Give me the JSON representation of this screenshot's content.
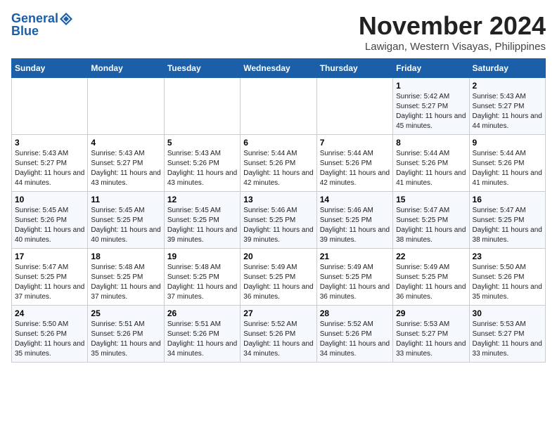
{
  "header": {
    "logo_general": "General",
    "logo_blue": "Blue",
    "month_title": "November 2024",
    "location": "Lawigan, Western Visayas, Philippines"
  },
  "days_of_week": [
    "Sunday",
    "Monday",
    "Tuesday",
    "Wednesday",
    "Thursday",
    "Friday",
    "Saturday"
  ],
  "weeks": [
    [
      {
        "day": "",
        "sunrise": "",
        "sunset": "",
        "daylight": ""
      },
      {
        "day": "",
        "sunrise": "",
        "sunset": "",
        "daylight": ""
      },
      {
        "day": "",
        "sunrise": "",
        "sunset": "",
        "daylight": ""
      },
      {
        "day": "",
        "sunrise": "",
        "sunset": "",
        "daylight": ""
      },
      {
        "day": "",
        "sunrise": "",
        "sunset": "",
        "daylight": ""
      },
      {
        "day": "1",
        "sunrise": "Sunrise: 5:42 AM",
        "sunset": "Sunset: 5:27 PM",
        "daylight": "Daylight: 11 hours and 45 minutes."
      },
      {
        "day": "2",
        "sunrise": "Sunrise: 5:43 AM",
        "sunset": "Sunset: 5:27 PM",
        "daylight": "Daylight: 11 hours and 44 minutes."
      }
    ],
    [
      {
        "day": "3",
        "sunrise": "Sunrise: 5:43 AM",
        "sunset": "Sunset: 5:27 PM",
        "daylight": "Daylight: 11 hours and 44 minutes."
      },
      {
        "day": "4",
        "sunrise": "Sunrise: 5:43 AM",
        "sunset": "Sunset: 5:27 PM",
        "daylight": "Daylight: 11 hours and 43 minutes."
      },
      {
        "day": "5",
        "sunrise": "Sunrise: 5:43 AM",
        "sunset": "Sunset: 5:26 PM",
        "daylight": "Daylight: 11 hours and 43 minutes."
      },
      {
        "day": "6",
        "sunrise": "Sunrise: 5:44 AM",
        "sunset": "Sunset: 5:26 PM",
        "daylight": "Daylight: 11 hours and 42 minutes."
      },
      {
        "day": "7",
        "sunrise": "Sunrise: 5:44 AM",
        "sunset": "Sunset: 5:26 PM",
        "daylight": "Daylight: 11 hours and 42 minutes."
      },
      {
        "day": "8",
        "sunrise": "Sunrise: 5:44 AM",
        "sunset": "Sunset: 5:26 PM",
        "daylight": "Daylight: 11 hours and 41 minutes."
      },
      {
        "day": "9",
        "sunrise": "Sunrise: 5:44 AM",
        "sunset": "Sunset: 5:26 PM",
        "daylight": "Daylight: 11 hours and 41 minutes."
      }
    ],
    [
      {
        "day": "10",
        "sunrise": "Sunrise: 5:45 AM",
        "sunset": "Sunset: 5:26 PM",
        "daylight": "Daylight: 11 hours and 40 minutes."
      },
      {
        "day": "11",
        "sunrise": "Sunrise: 5:45 AM",
        "sunset": "Sunset: 5:25 PM",
        "daylight": "Daylight: 11 hours and 40 minutes."
      },
      {
        "day": "12",
        "sunrise": "Sunrise: 5:45 AM",
        "sunset": "Sunset: 5:25 PM",
        "daylight": "Daylight: 11 hours and 39 minutes."
      },
      {
        "day": "13",
        "sunrise": "Sunrise: 5:46 AM",
        "sunset": "Sunset: 5:25 PM",
        "daylight": "Daylight: 11 hours and 39 minutes."
      },
      {
        "day": "14",
        "sunrise": "Sunrise: 5:46 AM",
        "sunset": "Sunset: 5:25 PM",
        "daylight": "Daylight: 11 hours and 39 minutes."
      },
      {
        "day": "15",
        "sunrise": "Sunrise: 5:47 AM",
        "sunset": "Sunset: 5:25 PM",
        "daylight": "Daylight: 11 hours and 38 minutes."
      },
      {
        "day": "16",
        "sunrise": "Sunrise: 5:47 AM",
        "sunset": "Sunset: 5:25 PM",
        "daylight": "Daylight: 11 hours and 38 minutes."
      }
    ],
    [
      {
        "day": "17",
        "sunrise": "Sunrise: 5:47 AM",
        "sunset": "Sunset: 5:25 PM",
        "daylight": "Daylight: 11 hours and 37 minutes."
      },
      {
        "day": "18",
        "sunrise": "Sunrise: 5:48 AM",
        "sunset": "Sunset: 5:25 PM",
        "daylight": "Daylight: 11 hours and 37 minutes."
      },
      {
        "day": "19",
        "sunrise": "Sunrise: 5:48 AM",
        "sunset": "Sunset: 5:25 PM",
        "daylight": "Daylight: 11 hours and 37 minutes."
      },
      {
        "day": "20",
        "sunrise": "Sunrise: 5:49 AM",
        "sunset": "Sunset: 5:25 PM",
        "daylight": "Daylight: 11 hours and 36 minutes."
      },
      {
        "day": "21",
        "sunrise": "Sunrise: 5:49 AM",
        "sunset": "Sunset: 5:25 PM",
        "daylight": "Daylight: 11 hours and 36 minutes."
      },
      {
        "day": "22",
        "sunrise": "Sunrise: 5:49 AM",
        "sunset": "Sunset: 5:25 PM",
        "daylight": "Daylight: 11 hours and 36 minutes."
      },
      {
        "day": "23",
        "sunrise": "Sunrise: 5:50 AM",
        "sunset": "Sunset: 5:26 PM",
        "daylight": "Daylight: 11 hours and 35 minutes."
      }
    ],
    [
      {
        "day": "24",
        "sunrise": "Sunrise: 5:50 AM",
        "sunset": "Sunset: 5:26 PM",
        "daylight": "Daylight: 11 hours and 35 minutes."
      },
      {
        "day": "25",
        "sunrise": "Sunrise: 5:51 AM",
        "sunset": "Sunset: 5:26 PM",
        "daylight": "Daylight: 11 hours and 35 minutes."
      },
      {
        "day": "26",
        "sunrise": "Sunrise: 5:51 AM",
        "sunset": "Sunset: 5:26 PM",
        "daylight": "Daylight: 11 hours and 34 minutes."
      },
      {
        "day": "27",
        "sunrise": "Sunrise: 5:52 AM",
        "sunset": "Sunset: 5:26 PM",
        "daylight": "Daylight: 11 hours and 34 minutes."
      },
      {
        "day": "28",
        "sunrise": "Sunrise: 5:52 AM",
        "sunset": "Sunset: 5:26 PM",
        "daylight": "Daylight: 11 hours and 34 minutes."
      },
      {
        "day": "29",
        "sunrise": "Sunrise: 5:53 AM",
        "sunset": "Sunset: 5:27 PM",
        "daylight": "Daylight: 11 hours and 33 minutes."
      },
      {
        "day": "30",
        "sunrise": "Sunrise: 5:53 AM",
        "sunset": "Sunset: 5:27 PM",
        "daylight": "Daylight: 11 hours and 33 minutes."
      }
    ]
  ]
}
